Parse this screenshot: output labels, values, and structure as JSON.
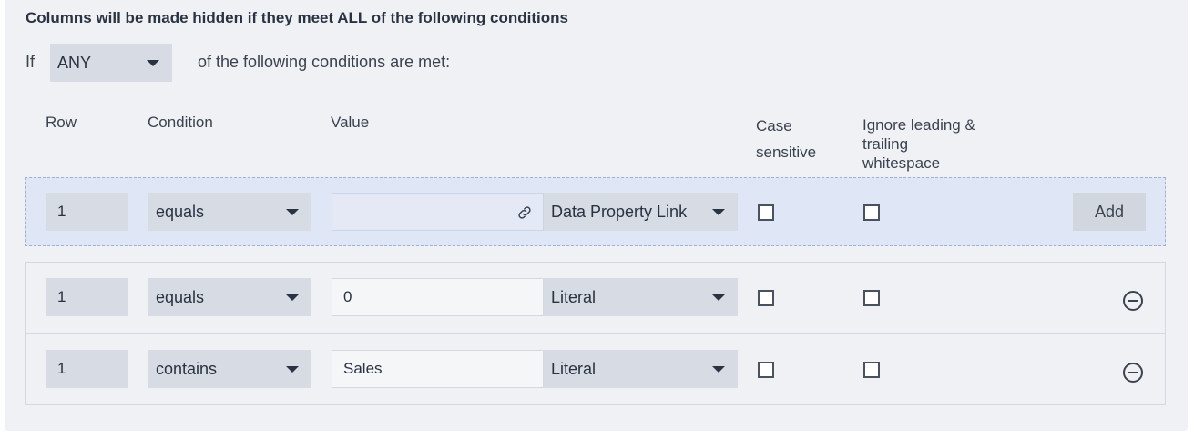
{
  "heading": "Columns will be made hidden if they meet ALL of the following conditions",
  "match": {
    "if_label": "If",
    "selected": "ANY",
    "suffix": "of the following conditions are met:"
  },
  "columns": {
    "row": "Row",
    "condition": "Condition",
    "value": "Value",
    "case_sensitive_1": "Case",
    "case_sensitive_2": "sensitive",
    "ignore_1": "Ignore leading &",
    "ignore_2": "trailing",
    "ignore_3": "whitespace"
  },
  "new_condition": {
    "row": "1",
    "condition": "equals",
    "value": "",
    "value_type": "Data Property Link",
    "case_sensitive": false,
    "ignore_whitespace": false,
    "add_label": "Add"
  },
  "conditions": [
    {
      "row": "1",
      "condition": "equals",
      "value": "0",
      "value_type": "Literal",
      "case_sensitive": false,
      "ignore_whitespace": false
    },
    {
      "row": "1",
      "condition": "contains",
      "value": "Sales",
      "value_type": "Literal",
      "case_sensitive": false,
      "ignore_whitespace": false
    }
  ],
  "icons": {
    "dropdown": "caret-down-icon",
    "link": "link-icon",
    "remove": "minus-circle-icon"
  },
  "colors": {
    "panel_bg": "#f0f1f5",
    "control_bg": "#d7dbe3",
    "add_row_bg": "#dfe6f5",
    "add_row_border": "#9db2d6"
  }
}
